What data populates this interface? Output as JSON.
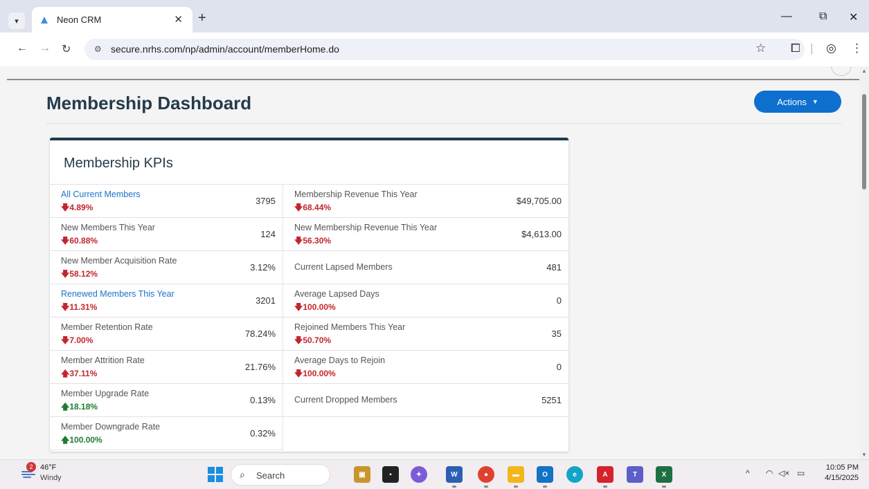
{
  "browser": {
    "tab_title": "Neon CRM",
    "tab_close": "✕",
    "new_tab": "+",
    "url": "secure.nrhs.com/np/admin/account/memberHome.do"
  },
  "page": {
    "title": "Membership Dashboard",
    "actions_label": "Actions",
    "card_title": "Membership KPIs"
  },
  "kpis_left": [
    {
      "label": "All Current Members",
      "change": "4.89%",
      "dir": "down",
      "value": "3795",
      "link": true
    },
    {
      "label": "New Members This Year",
      "change": "60.88%",
      "dir": "down",
      "value": "124",
      "link": false
    },
    {
      "label": "New Member Acquisition Rate",
      "change": "58.12%",
      "dir": "down",
      "value": "3.12%",
      "link": false
    },
    {
      "label": "Renewed Members This Year",
      "change": "11.31%",
      "dir": "down",
      "value": "3201",
      "link": true
    },
    {
      "label": "Member Retention Rate",
      "change": "7.00%",
      "dir": "down",
      "value": "78.24%",
      "link": false
    },
    {
      "label": "Member Attrition Rate",
      "change": "37.11%",
      "dir": "up-bad",
      "value": "21.76%",
      "link": false
    },
    {
      "label": "Member Upgrade Rate",
      "change": "18.18%",
      "dir": "up-good",
      "value": "0.13%",
      "link": false
    },
    {
      "label": "Member Downgrade Rate",
      "change": "100.00%",
      "dir": "up-good",
      "value": "0.32%",
      "link": false
    }
  ],
  "kpis_right": [
    {
      "label": "Membership Revenue This Year",
      "change": "68.44%",
      "dir": "down",
      "value": "$49,705.00"
    },
    {
      "label": "New Membership Revenue This Year",
      "change": "56.30%",
      "dir": "down",
      "value": "$4,613.00"
    },
    {
      "label": "Current Lapsed Members",
      "change": "",
      "dir": "",
      "value": "481"
    },
    {
      "label": "Average Lapsed Days",
      "change": "100.00%",
      "dir": "down",
      "value": "0"
    },
    {
      "label": "Rejoined Members This Year",
      "change": "50.70%",
      "dir": "down",
      "value": "35"
    },
    {
      "label": "Average Days to Rejoin",
      "change": "100.00%",
      "dir": "down",
      "value": "0"
    },
    {
      "label": "Current Dropped Members",
      "change": "",
      "dir": "",
      "value": "5251"
    }
  ],
  "taskbar": {
    "weather_badge": "2",
    "weather_temp": "46°F",
    "weather_desc": "Windy",
    "search_label": "Search",
    "time": "10:05 PM",
    "date": "4/15/2025"
  },
  "colors": {
    "accent": "#0e6fcf",
    "negative": "#c4262e",
    "positive": "#1e7d32",
    "link": "#1a73c9",
    "card_border": "#1f3a4c"
  }
}
